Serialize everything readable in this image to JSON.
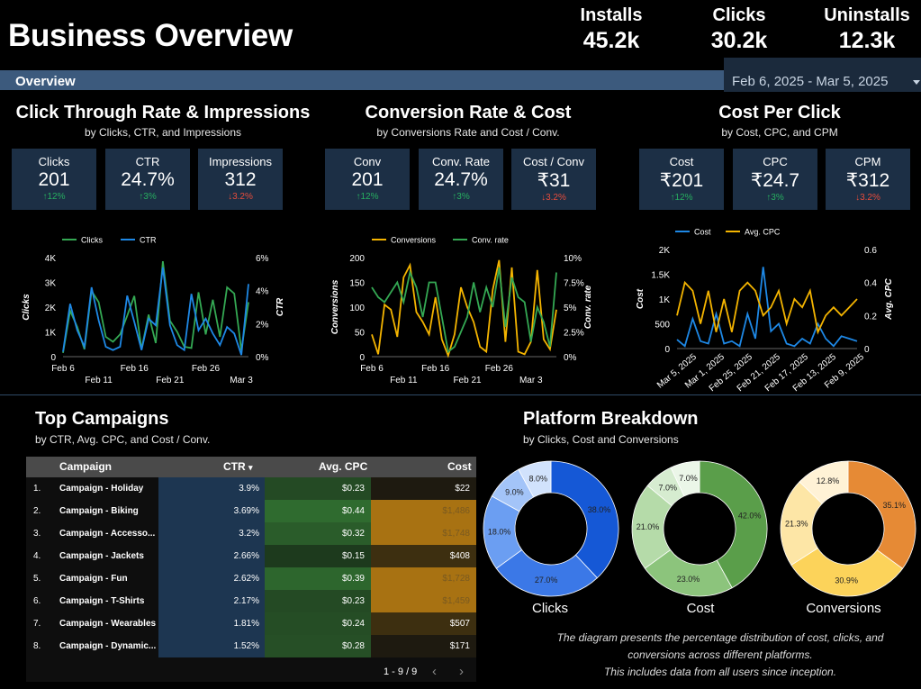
{
  "header": {
    "title": "Business Overview",
    "kpis": [
      {
        "label": "Installs",
        "value": "45.2k"
      },
      {
        "label": "Clicks",
        "value": "30.2k"
      },
      {
        "label": "Uninstalls",
        "value": "12.3k"
      }
    ],
    "overview_label": "Overview",
    "date_range": "Feb 6, 2025 - Mar 5, 2025"
  },
  "sections": {
    "ctr": {
      "title": "Click Through Rate & Impressions",
      "subtitle": "by Clicks, CTR, and Impressions"
    },
    "conv": {
      "title": "Conversion Rate & Cost",
      "subtitle": "by Conversions Rate and Cost / Conv."
    },
    "cpc": {
      "title": "Cost Per Click",
      "subtitle": "by Cost, CPC, and CPM"
    },
    "campaigns": {
      "title": "Top Campaigns",
      "subtitle": "by CTR, Avg. CPC, and Cost / Conv."
    },
    "platform": {
      "title": "Platform Breakdown",
      "subtitle": "by Clicks, Cost  and Conversions"
    }
  },
  "cards": {
    "ctr": [
      {
        "label": "Clicks",
        "value": "201",
        "delta": "↑12%",
        "dir": "up"
      },
      {
        "label": "CTR",
        "value": "24.7%",
        "delta": "↑3%",
        "dir": "up"
      },
      {
        "label": "Impressions",
        "value": "312",
        "delta": "↓3.2%",
        "dir": "dn"
      }
    ],
    "conv": [
      {
        "label": "Conv",
        "value": "201",
        "delta": "↑12%",
        "dir": "up"
      },
      {
        "label": "Conv. Rate",
        "value": "24.7%",
        "delta": "↑3%",
        "dir": "up"
      },
      {
        "label": "Cost / Conv",
        "value": "₹31",
        "delta": "↓3.2%",
        "dir": "dn"
      }
    ],
    "cpc": [
      {
        "label": "Cost",
        "value": "₹201",
        "delta": "↑12%",
        "dir": "up"
      },
      {
        "label": "CPC",
        "value": "₹24.7",
        "delta": "↑3%",
        "dir": "up"
      },
      {
        "label": "CPM",
        "value": "₹312",
        "delta": "↓3.2%",
        "dir": "dn"
      }
    ]
  },
  "chart_data": [
    {
      "type": "line",
      "series": [
        {
          "name": "Clicks",
          "color": "#34a853",
          "axis": "left",
          "values": [
            150,
            1850,
            1200,
            300,
            2650,
            2200,
            800,
            600,
            900,
            1650,
            2450,
            300,
            1700,
            550,
            3850,
            1450,
            1000,
            400,
            350,
            2600,
            900,
            2300,
            800,
            2800,
            2550,
            250,
            2200
          ]
        },
        {
          "name": "CTR",
          "color": "#1e88e5",
          "axis": "right",
          "values": [
            0.3,
            3.2,
            1.6,
            0.6,
            4.2,
            2.2,
            0.6,
            0.4,
            0.6,
            3.7,
            2.1,
            0.4,
            2.3,
            1.9,
            5.4,
            1.9,
            0.7,
            0.4,
            3.8,
            1.6,
            2.3,
            1.4,
            0.7,
            1.8,
            1.4,
            0.1,
            4.4
          ]
        }
      ],
      "y_left": {
        "label": "Clicks",
        "ticks": [
          "0",
          "1K",
          "2K",
          "3K",
          "4K"
        ],
        "ylim": [
          0,
          4000
        ]
      },
      "y_right": {
        "label": "CTR",
        "ticks": [
          "0%",
          "2%",
          "4%",
          "6%"
        ],
        "ylim": [
          0,
          6
        ]
      },
      "x_ticks_top": [
        "Feb 6",
        "Feb 16",
        "Feb 26"
      ],
      "x_ticks_bottom": [
        "Feb 11",
        "Feb 21",
        "Mar 3"
      ],
      "legend": "top"
    },
    {
      "type": "line",
      "series": [
        {
          "name": "Conversions",
          "color": "#f4b400",
          "axis": "left",
          "values": [
            45,
            5,
            105,
            95,
            40,
            160,
            185,
            90,
            70,
            45,
            120,
            35,
            2,
            45,
            140,
            100,
            70,
            20,
            10,
            135,
            195,
            30,
            180,
            10,
            5,
            30,
            175,
            35,
            15,
            95
          ]
        },
        {
          "name": "Conv. rate",
          "color": "#34a853",
          "axis": "right",
          "values": [
            7,
            6,
            5.5,
            6.5,
            7.5,
            5.5,
            8.5,
            7,
            4,
            7.5,
            7.5,
            4,
            0.5,
            1,
            2.5,
            4,
            7.5,
            4.5,
            7,
            5,
            9,
            3,
            8,
            6,
            5.5,
            1.5,
            5,
            3.5,
            1,
            8.5
          ]
        }
      ],
      "y_left": {
        "label": "Conversions",
        "ticks": [
          "0",
          "50",
          "100",
          "150",
          "200"
        ],
        "ylim": [
          0,
          200
        ]
      },
      "y_right": {
        "label": "Conv. rate",
        "ticks": [
          "0%",
          "2.5%",
          "5%",
          "7.5%",
          "10%"
        ],
        "ylim": [
          0,
          10
        ]
      },
      "x_ticks_top": [
        "Feb 6",
        "Feb 16",
        "Feb 26"
      ],
      "x_ticks_bottom": [
        "Feb 11",
        "Feb 21",
        "Mar 3"
      ],
      "legend": "top"
    },
    {
      "type": "line",
      "series": [
        {
          "name": "Cost",
          "color": "#1e88e5",
          "axis": "left",
          "values": [
            180,
            50,
            600,
            150,
            100,
            700,
            100,
            150,
            50,
            700,
            200,
            1650,
            350,
            500,
            100,
            50,
            200,
            100,
            500,
            200,
            50,
            250,
            200,
            150
          ]
        },
        {
          "name": "Avg. CPC",
          "color": "#f4b400",
          "axis": "right",
          "values": [
            0.2,
            0.4,
            0.35,
            0.15,
            0.35,
            0.1,
            0.3,
            0.1,
            0.35,
            0.4,
            0.35,
            0.2,
            0.25,
            0.35,
            0.15,
            0.3,
            0.25,
            0.35,
            0.1,
            0.2,
            0.25,
            0.2,
            0.25,
            0.3
          ]
        }
      ],
      "y_left": {
        "label": "Cost",
        "ticks": [
          "0",
          "500",
          "1K",
          "1.5K",
          "2K"
        ],
        "ylim": [
          0,
          2000
        ]
      },
      "y_right": {
        "label": "Avg. CPC",
        "ticks": [
          "0",
          "0.2",
          "0.4",
          "0.6"
        ],
        "ylim": [
          0,
          0.6
        ]
      },
      "x_ticks": [
        "Mar 5, 2025",
        "Mar 1, 2025",
        "Feb 25, 2025",
        "Feb 21, 2025",
        "Feb 17, 2025",
        "Feb 13, 2025",
        "Feb 9, 2025"
      ],
      "legend": "top"
    },
    {
      "type": "pie",
      "label": "Clicks",
      "slices": [
        38.0,
        27.0,
        18.0,
        9.0,
        8.0
      ],
      "labels": [
        "38.0%",
        "27.0%",
        "18.0%",
        "9.0%",
        "8.0%"
      ],
      "colors": [
        "#1558d6",
        "#3b78e7",
        "#6b9ef2",
        "#a3c4f8",
        "#d1e2fc"
      ]
    },
    {
      "type": "pie",
      "label": "Cost",
      "slices": [
        42.0,
        23.0,
        21.0,
        7.0,
        7.0
      ],
      "labels": [
        "42.0%",
        "23.0%",
        "21.0%",
        "7.0%",
        "7.0%"
      ],
      "colors": [
        "#5a9e4a",
        "#8cc47c",
        "#b5dba9",
        "#d6ecd0",
        "#ebf6e8"
      ]
    },
    {
      "type": "pie",
      "label": "Conversions",
      "slices": [
        35.1,
        30.9,
        21.3,
        12.8
      ],
      "labels": [
        "35.1%",
        "30.9%",
        "21.3%",
        "12.8%"
      ],
      "colors": [
        "#e68a35",
        "#fcd35a",
        "#fde6a6",
        "#fff2d6"
      ]
    }
  ],
  "table": {
    "headers": {
      "campaign": "Campaign",
      "ctr": "CTR",
      "cpc": "Avg. CPC",
      "cost": "Cost"
    },
    "rows": [
      {
        "n": "1.",
        "name": "Campaign - Holiday",
        "ctr": "3.9%",
        "cpc": "$0.23",
        "cost": "$22"
      },
      {
        "n": "2.",
        "name": "Campaign - Biking",
        "ctr": "3.69%",
        "cpc": "$0.44",
        "cost": "$1,486"
      },
      {
        "n": "3.",
        "name": "Campaign - Accesso...",
        "ctr": "3.2%",
        "cpc": "$0.32",
        "cost": "$1,748"
      },
      {
        "n": "4.",
        "name": "Campaign - Jackets",
        "ctr": "2.66%",
        "cpc": "$0.15",
        "cost": "$408"
      },
      {
        "n": "5.",
        "name": "Campaign - Fun",
        "ctr": "2.62%",
        "cpc": "$0.39",
        "cost": "$1,728"
      },
      {
        "n": "6.",
        "name": "Campaign - T-Shirts",
        "ctr": "2.17%",
        "cpc": "$0.23",
        "cost": "$1,459"
      },
      {
        "n": "7.",
        "name": "Campaign - Wearables",
        "ctr": "1.81%",
        "cpc": "$0.24",
        "cost": "$507"
      },
      {
        "n": "8.",
        "name": "Campaign - Dynamic...",
        "ctr": "1.52%",
        "cpc": "$0.28",
        "cost": "$171"
      }
    ],
    "pager": "1 - 9 / 9"
  },
  "caption": {
    "line1": "The diagram presents the percentage distribution of cost, clicks, and",
    "line2": "conversions across different platforms.",
    "line3": "This includes data from all users since inception."
  }
}
